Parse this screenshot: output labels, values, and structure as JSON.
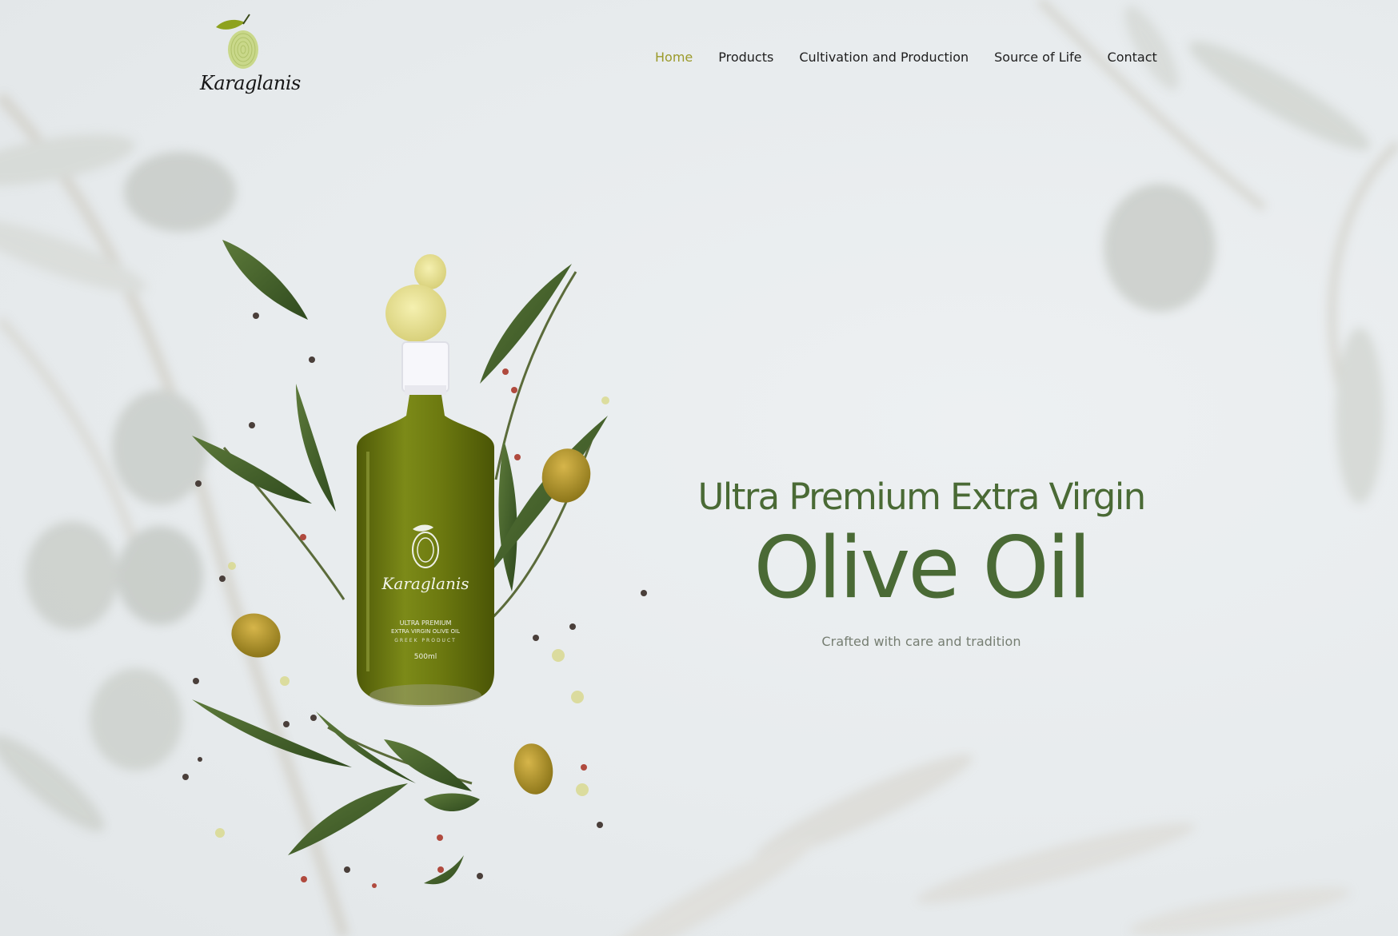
{
  "brand": {
    "logo_text": "Karaglanis",
    "logo_icon": "olive-fingerprint-icon"
  },
  "nav": {
    "items": [
      {
        "label": "Home",
        "active": true
      },
      {
        "label": "Products",
        "active": false
      },
      {
        "label": "Cultivation and Production",
        "active": false
      },
      {
        "label": "Source of Life",
        "active": false
      },
      {
        "label": "Contact",
        "active": false
      }
    ]
  },
  "hero": {
    "line1": "Ultra Premium Extra Virgin",
    "line2": "Olive Oil",
    "subtitle": "Crafted with care and tradition"
  },
  "bottle_label": {
    "brand": "Karaglanis",
    "line1": "ULTRA PREMIUM",
    "line2": "EXTRA VIRGIN OLIVE OIL",
    "line3": "GREEK PRODUCT",
    "volume": "500ml"
  },
  "colors": {
    "background": "#e8ecee",
    "accent_nav": "#9b9a2a",
    "heading_green": "#4a6a35",
    "oil_green": "#6b7a10"
  }
}
